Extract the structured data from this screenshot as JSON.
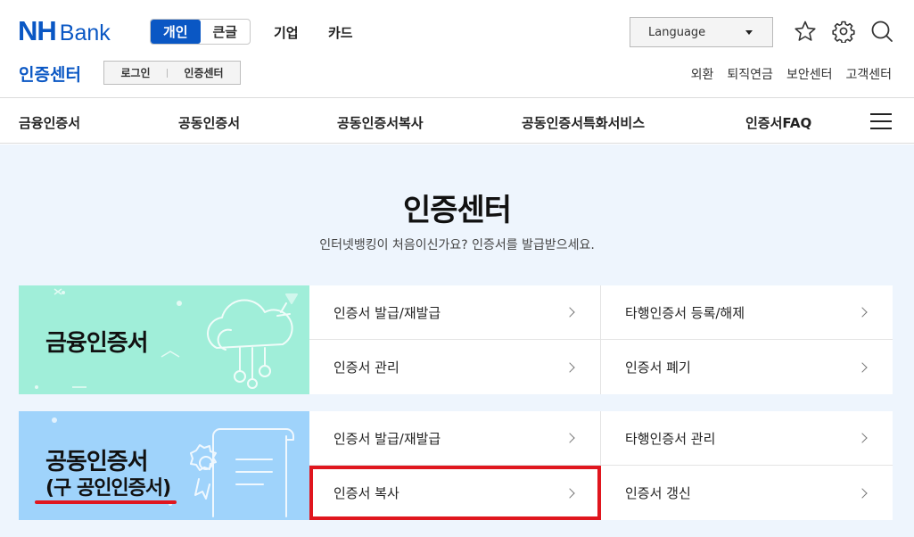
{
  "header": {
    "logo_nh": "NH",
    "logo_bank": "Bank",
    "modes": [
      "개인",
      "큰글"
    ],
    "active_mode": "개인",
    "links": [
      "기업",
      "카드"
    ],
    "language_label": "Language",
    "icons": [
      "star-icon",
      "gear-icon",
      "search-icon"
    ]
  },
  "subheader": {
    "section_title": "인증센터",
    "login_label": "로그인",
    "cert_center_label": "인증센터",
    "util_links": [
      "외환",
      "퇴직연금",
      "보안센터",
      "고객센터"
    ]
  },
  "nav": {
    "items": [
      "금융인증서",
      "공동인증서",
      "공동인증서복사",
      "공동인증서특화서비스",
      "인증서FAQ"
    ],
    "menu_icon": "hamburger-icon"
  },
  "main": {
    "title": "인증센터",
    "subtitle": "인터넷뱅킹이 처음이신가요? 인증서를 발급받으세요.",
    "cards": [
      {
        "title": "금융인증서",
        "banner_color": "#a0eed9",
        "links": [
          "인증서 발급/재발급",
          "타행인증서 등록/해제",
          "인증서 관리",
          "인증서 폐기"
        ]
      },
      {
        "title": "공동인증서",
        "subtitle": "(구 공인인증서)",
        "banner_color": "#9fd3fb",
        "links": [
          "인증서 발급/재발급",
          "타행인증서 관리",
          "인증서 복사",
          "인증서 갱신"
        ],
        "highlighted_link": "인증서 복사"
      }
    ]
  },
  "colors": {
    "brand_blue": "#0a57c4",
    "highlight_red": "#e0161e",
    "page_bg": "#eef5fd"
  }
}
